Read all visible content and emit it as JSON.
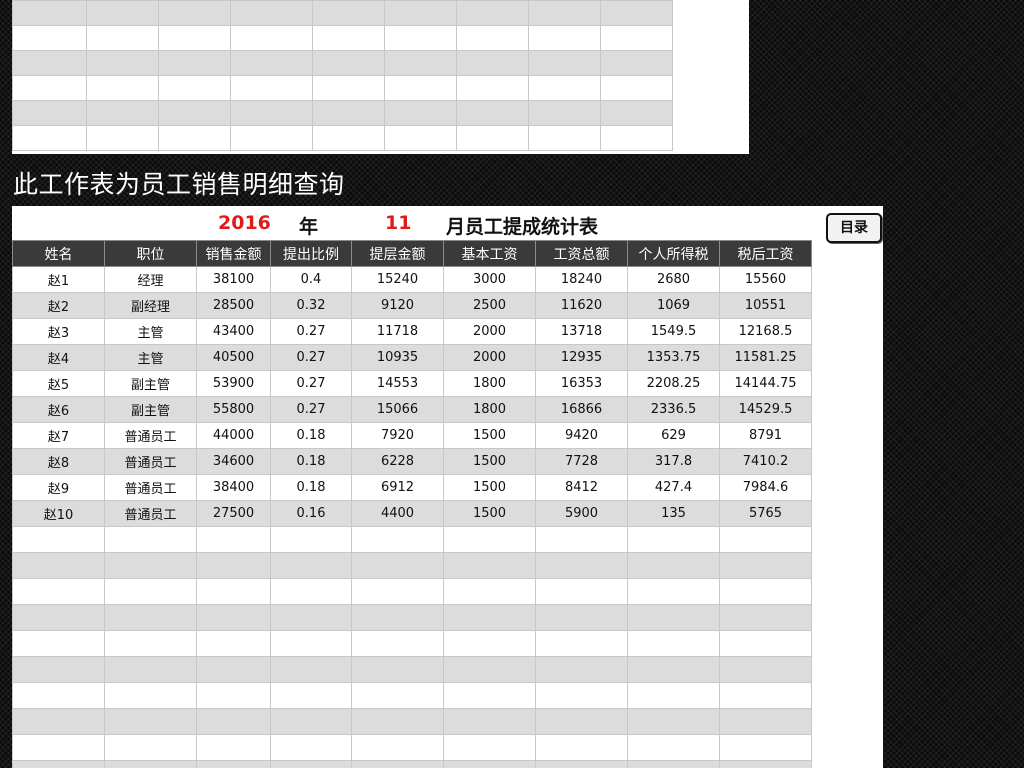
{
  "caption": "此工作表为员工销售明细查询",
  "title": {
    "year": "2016",
    "year_unit": "年",
    "month": "11",
    "text": "月员工提成统计表"
  },
  "menu_button": "目录",
  "table": {
    "headers": [
      "姓名",
      "职位",
      "销售金额",
      "提出比例",
      "提层金额",
      "基本工资",
      "工资总额",
      "个人所得税",
      "税后工资"
    ],
    "rows": [
      [
        "赵1",
        "经理",
        "38100",
        "0.4",
        "15240",
        "3000",
        "18240",
        "2680",
        "15560"
      ],
      [
        "赵2",
        "副经理",
        "28500",
        "0.32",
        "9120",
        "2500",
        "11620",
        "1069",
        "10551"
      ],
      [
        "赵3",
        "主管",
        "43400",
        "0.27",
        "11718",
        "2000",
        "13718",
        "1549.5",
        "12168.5"
      ],
      [
        "赵4",
        "主管",
        "40500",
        "0.27",
        "10935",
        "2000",
        "12935",
        "1353.75",
        "11581.25"
      ],
      [
        "赵5",
        "副主管",
        "53900",
        "0.27",
        "14553",
        "1800",
        "16353",
        "2208.25",
        "14144.75"
      ],
      [
        "赵6",
        "副主管",
        "55800",
        "0.27",
        "15066",
        "1800",
        "16866",
        "2336.5",
        "14529.5"
      ],
      [
        "赵7",
        "普通员工",
        "44000",
        "0.18",
        "7920",
        "1500",
        "9420",
        "629",
        "8791"
      ],
      [
        "赵8",
        "普通员工",
        "34600",
        "0.18",
        "6228",
        "1500",
        "7728",
        "317.8",
        "7410.2"
      ],
      [
        "赵9",
        "普通员工",
        "38400",
        "0.18",
        "6912",
        "1500",
        "8412",
        "427.4",
        "7984.6"
      ],
      [
        "赵10",
        "普通员工",
        "27500",
        "0.16",
        "4400",
        "1500",
        "5900",
        "135",
        "5765"
      ]
    ]
  }
}
